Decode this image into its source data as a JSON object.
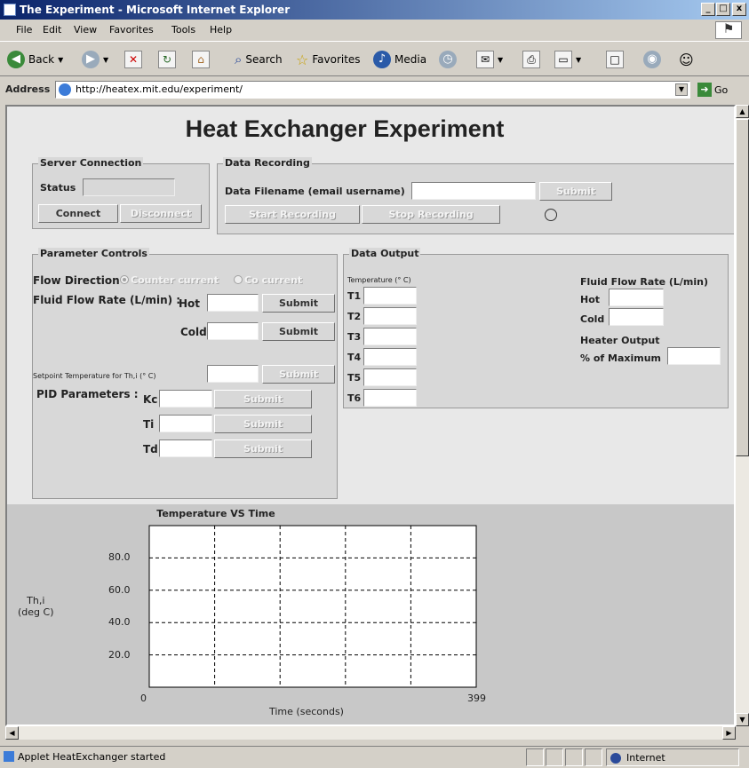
{
  "window": {
    "title": "The Experiment - Microsoft Internet Explorer",
    "minimize": "_",
    "maximize": "□",
    "close": "x"
  },
  "menu": [
    "File",
    "Edit",
    "View",
    "Favorites",
    "Tools",
    "Help"
  ],
  "toolbar": {
    "back": "Back",
    "search": "Search",
    "favorites": "Favorites",
    "media": "Media"
  },
  "address": {
    "label": "Address",
    "url": "http://heatex.mit.edu/experiment/",
    "go": "Go"
  },
  "page": {
    "heading": "Heat Exchanger Experiment",
    "server": {
      "legend": "Server Connection",
      "status_label": "Status",
      "connect": "Connect",
      "disconnect": "Disconnect"
    },
    "recording": {
      "legend": "Data Recording",
      "filename_label": "Data Filename (email username)",
      "submit": "Submit",
      "start": "Start Recording",
      "stop": "Stop Recording"
    },
    "params": {
      "legend": "Parameter Controls",
      "flow_direction_label": "Flow Direction",
      "counter_current": "Counter current",
      "co_current": "Co current",
      "flow_rate_label": "Fluid Flow Rate (L/min) :",
      "hot": "Hot",
      "cold": "Cold",
      "submit": "Submit",
      "setpoint_label": "Setpoint Temperature for Th,i (° C)",
      "pid_label": "PID Parameters :",
      "kc": "Kc",
      "ti": "Ti",
      "td": "Td"
    },
    "output": {
      "legend": "Data Output",
      "temperature_label": "Temperature (° C)",
      "sensors": [
        "T1",
        "T2",
        "T3",
        "T4",
        "T5",
        "T6"
      ],
      "flow_rate_label": "Fluid Flow Rate (L/min)",
      "hot": "Hot",
      "cold": "Cold",
      "heater_label": "Heater Output",
      "heater_pct_label": "% of Maximum"
    }
  },
  "chart_data": {
    "type": "line",
    "title": "Temperature VS Time",
    "xlabel": "Time (seconds)",
    "ylabel": "Th,i\n(deg C)",
    "x_ticks": [
      "0",
      "399"
    ],
    "y_ticks": [
      "80.0",
      "60.0",
      "40.0",
      "20.0"
    ],
    "xlim": [
      0,
      399
    ],
    "ylim": [
      0,
      100
    ],
    "grid": true,
    "series": []
  },
  "status": {
    "text": "Applet HeatExchanger started",
    "zone": "Internet"
  }
}
